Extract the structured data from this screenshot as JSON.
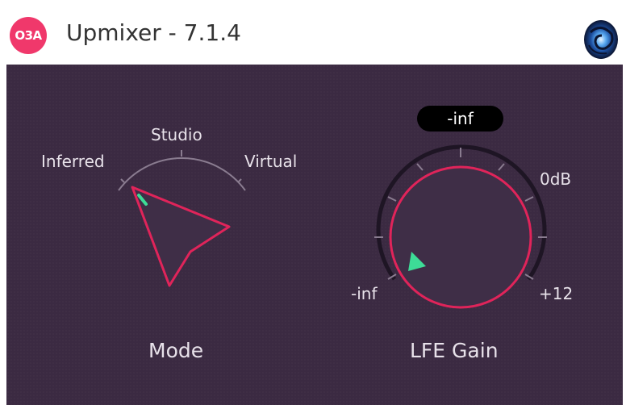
{
  "header": {
    "logo_text": "O3A",
    "title": "Upmixer - 7.1.4",
    "brand_icon": "spiral-galaxy-icon"
  },
  "colors": {
    "panel_bg": "#3b2a42",
    "accent_red": "#e0245a",
    "accent_green": "#3ddc97",
    "logo_pink": "#f0386b"
  },
  "mode_knob": {
    "label": "Mode",
    "options": [
      "Inferred",
      "Studio",
      "Virtual"
    ],
    "selected": "Inferred"
  },
  "lfe_gain_knob": {
    "label": "LFE Gain",
    "value_display": "-inf",
    "min_label": "-inf",
    "mid_label": "0dB",
    "max_label": "+12",
    "position_fraction": 0.0
  }
}
